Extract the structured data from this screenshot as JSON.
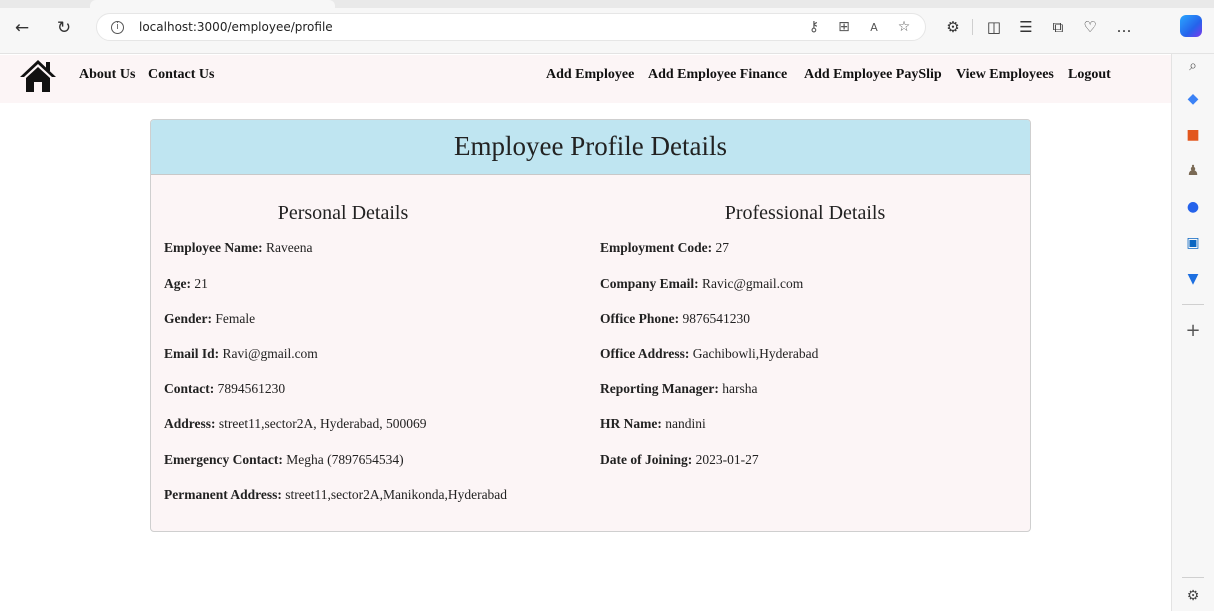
{
  "browser": {
    "url": "localhost:3000/employee/profile",
    "back_icon": "back-arrow-icon",
    "refresh_icon": "refresh-icon"
  },
  "nav": {
    "left_links": [
      "About Us",
      "Contact Us"
    ],
    "right_links": [
      "Add Employee",
      "Add Employee Finance",
      "Add Employee PaySlip",
      "View Employees",
      "Logout"
    ]
  },
  "card": {
    "title": "Employee Profile Details",
    "personal": {
      "heading": "Personal Details",
      "fields": [
        {
          "label": "Employee Name:",
          "value": "Raveena"
        },
        {
          "label": "Age:",
          "value": "21"
        },
        {
          "label": "Gender:",
          "value": "Female"
        },
        {
          "label": "Email Id:",
          "value": "Ravi@gmail.com"
        },
        {
          "label": "Contact:",
          "value": "7894561230"
        },
        {
          "label": "Address:",
          "value": "street11,sector2A, Hyderabad, 500069"
        },
        {
          "label": "Emergency Contact:",
          "value": "Megha (7897654534)"
        },
        {
          "label": "Permanent Address:",
          "value": "street11,sector2A,Manikonda,Hyderabad"
        }
      ]
    },
    "professional": {
      "heading": "Professional Details",
      "fields": [
        {
          "label": "Employment Code:",
          "value": "27"
        },
        {
          "label": "Company Email:",
          "value": "Ravic@gmail.com"
        },
        {
          "label": "Office Phone:",
          "value": "9876541230"
        },
        {
          "label": "Office Address:",
          "value": "Gachibowli,Hyderabad"
        },
        {
          "label": "Reporting Manager:",
          "value": "harsha"
        },
        {
          "label": "HR Name:",
          "value": "nandini"
        },
        {
          "label": "Date of Joining:",
          "value": "2023-01-27"
        }
      ]
    }
  },
  "colors": {
    "navbar_bg": "#fcf5f6",
    "card_header_bg": "#bfe5f1",
    "card_bg": "#fcf5f6"
  }
}
